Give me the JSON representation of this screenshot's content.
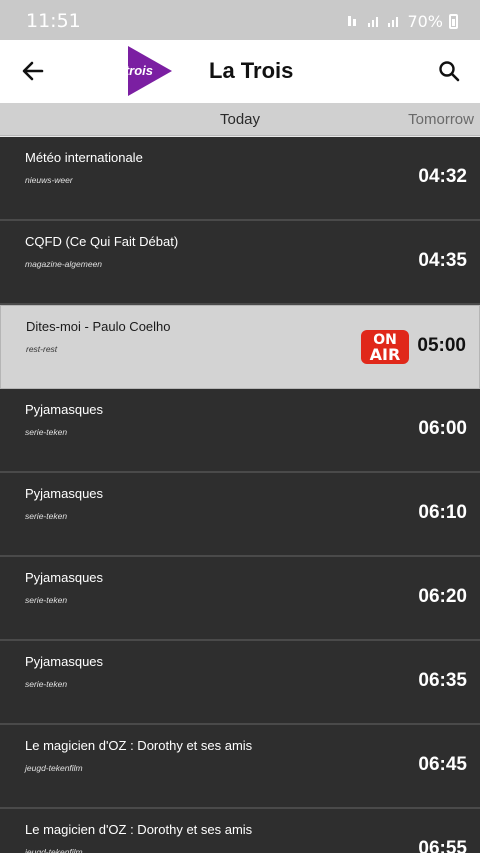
{
  "status_bar": {
    "time": "11:51",
    "battery": "70%"
  },
  "app_bar": {
    "title": "La Trois",
    "logo_text": "latrois"
  },
  "tabs": {
    "today": "Today",
    "tomorrow": "Tomorrow"
  },
  "on_air": {
    "line1": "ON",
    "line2": "AIR"
  },
  "programs": [
    {
      "title": "Météo internationale",
      "category": "nieuws-weer",
      "time": "04:32"
    },
    {
      "title": "CQFD (Ce Qui Fait Débat)",
      "category": "magazine-algemeen",
      "time": "04:35"
    },
    {
      "title": "Dites-moi - Paulo Coelho",
      "category": "rest-rest",
      "time": "05:00"
    },
    {
      "title": "Pyjamasques",
      "category": "serie-teken",
      "time": "06:00"
    },
    {
      "title": "Pyjamasques",
      "category": "serie-teken",
      "time": "06:10"
    },
    {
      "title": "Pyjamasques",
      "category": "serie-teken",
      "time": "06:20"
    },
    {
      "title": "Pyjamasques",
      "category": "serie-teken",
      "time": "06:35"
    },
    {
      "title": "Le magicien d'OZ : Dorothy et ses amis",
      "category": "jeugd-tekenfilm",
      "time": "06:45"
    },
    {
      "title": "Le magicien d'OZ : Dorothy et ses amis",
      "category": "jeugd-tekenfilm",
      "time": "06:55"
    }
  ],
  "colors": {
    "accent": "#7b1fa2",
    "on_air": "#e0281a",
    "row_bg": "#2e2e2e",
    "active_row_bg": "#d3d3d3"
  }
}
